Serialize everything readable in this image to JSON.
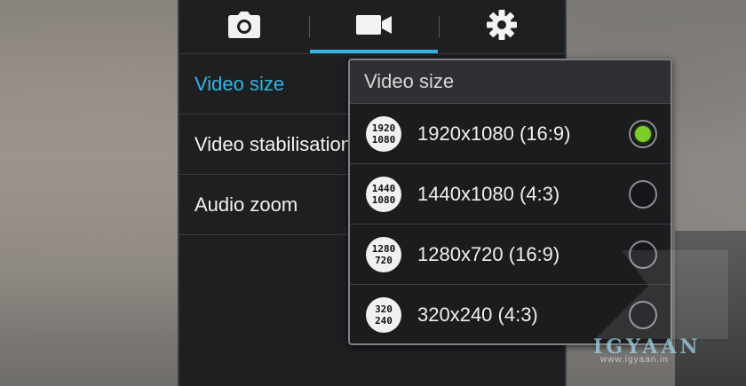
{
  "tabs": [
    {
      "name": "camera-icon"
    },
    {
      "name": "video-camera-icon",
      "active": true
    },
    {
      "name": "gear-icon"
    }
  ],
  "menu": {
    "items": [
      {
        "label": "Video size",
        "active": true
      },
      {
        "label": "Video stabilisation"
      },
      {
        "label": "Audio zoom"
      }
    ]
  },
  "popup": {
    "title": "Video size",
    "options": [
      {
        "label": "1920x1080 (16:9)",
        "icon_top": "1920",
        "icon_bottom": "1080",
        "selected": true
      },
      {
        "label": "1440x1080 (4:3)",
        "icon_top": "1440",
        "icon_bottom": "1080",
        "selected": false
      },
      {
        "label": "1280x720 (16:9)",
        "icon_top": "1280",
        "icon_bottom": "720",
        "selected": false
      },
      {
        "label": "320x240 (4:3)",
        "icon_top": "320",
        "icon_bottom": "240",
        "selected": false
      }
    ]
  },
  "watermark": {
    "logo": "IGYAAN",
    "url": "www.igyaan.in"
  },
  "colors": {
    "accent": "#33b5e5",
    "selected_radio": "#7ccc2c",
    "panel_bg": "#1e1f21"
  }
}
